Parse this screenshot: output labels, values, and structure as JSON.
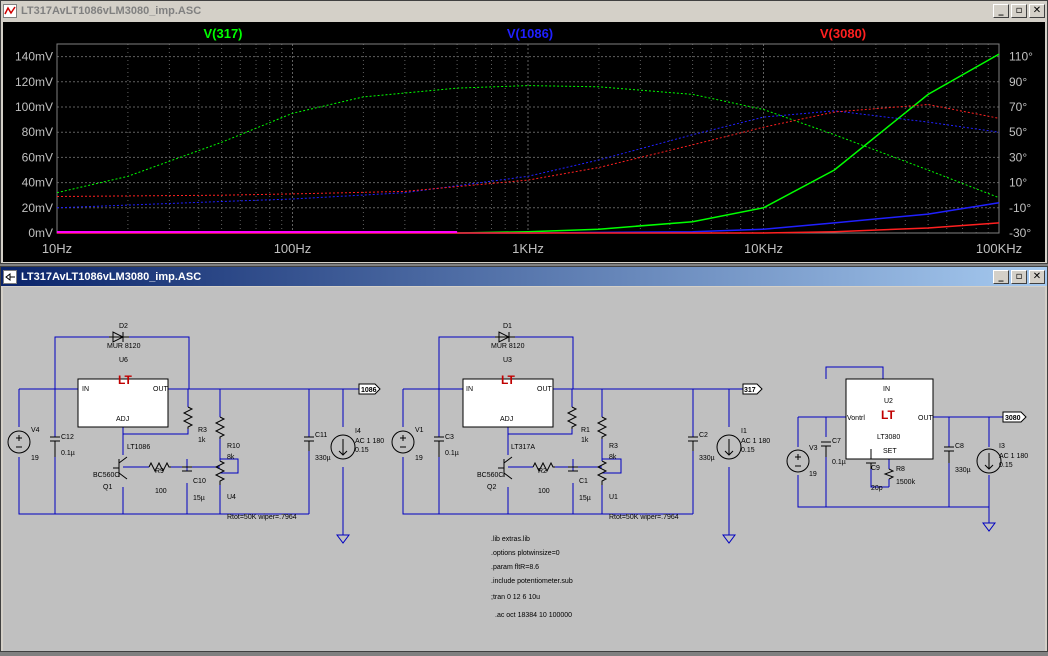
{
  "plot_window": {
    "title": "LT317AvLT1086vLM3080_imp.ASC",
    "buttons": {
      "minimize": "_",
      "restore": "▫",
      "close": "✕"
    }
  },
  "schematic_window": {
    "title": "LT317AvLT1086vLM3080_imp.ASC",
    "buttons": {
      "minimize": "_",
      "restore": "▫",
      "close": "✕"
    }
  },
  "colors": {
    "green": "#00ff00",
    "blue": "#2020ff",
    "red": "#ff2020",
    "wire": "#0000c0",
    "component": "#000000",
    "grid": "#606060"
  },
  "chart_data": {
    "type": "line",
    "xscale": "log",
    "xlim": [
      10,
      100000
    ],
    "x_ticks": [
      "10Hz",
      "100Hz",
      "1KHz",
      "10KHz",
      "100KHz"
    ],
    "ylim_left": [
      0,
      150
    ],
    "y_ticks_left": [
      "0mV",
      "20mV",
      "40mV",
      "60mV",
      "80mV",
      "100mV",
      "120mV",
      "140mV"
    ],
    "ylim_right": [
      -30,
      120
    ],
    "y_ticks_right": [
      "-30°",
      "-10°",
      "10°",
      "30°",
      "50°",
      "70°",
      "90°",
      "110°"
    ],
    "legend": [
      "V(317)",
      "V(1086)",
      "V(3080)"
    ],
    "series": [
      {
        "name": "V(317)",
        "color": "#00ff00",
        "magnitude": [
          [
            10,
            32
          ],
          [
            20,
            45
          ],
          [
            50,
            72
          ],
          [
            100,
            95
          ],
          [
            200,
            108
          ],
          [
            500,
            115
          ],
          [
            1000,
            117
          ],
          [
            2000,
            116
          ],
          [
            5000,
            110
          ],
          [
            10000,
            98
          ],
          [
            20000,
            78
          ],
          [
            50000,
            50
          ],
          [
            100000,
            28
          ]
        ],
        "phase": [
          [
            500,
            -30
          ],
          [
            1000,
            -29
          ],
          [
            2000,
            -27
          ],
          [
            5000,
            -21
          ],
          [
            10000,
            -10
          ],
          [
            20000,
            20
          ],
          [
            50000,
            80
          ],
          [
            100000,
            112
          ]
        ]
      },
      {
        "name": "V(1086)",
        "color": "#2020ff",
        "magnitude": [
          [
            10,
            20
          ],
          [
            50,
            25
          ],
          [
            100,
            27
          ],
          [
            300,
            32
          ],
          [
            1000,
            45
          ],
          [
            2000,
            58
          ],
          [
            5000,
            78
          ],
          [
            10000,
            92
          ],
          [
            20000,
            97
          ],
          [
            50000,
            88
          ],
          [
            100000,
            80
          ]
        ],
        "phase": [
          [
            10,
            -30
          ],
          [
            1000,
            -30
          ],
          [
            5000,
            -29
          ],
          [
            10000,
            -27
          ],
          [
            20000,
            -22
          ],
          [
            50000,
            -15
          ],
          [
            100000,
            -6
          ]
        ]
      },
      {
        "name": "V(3080)",
        "color": "#ff2020",
        "magnitude": [
          [
            10,
            29
          ],
          [
            50,
            30
          ],
          [
            100,
            31
          ],
          [
            300,
            33
          ],
          [
            1000,
            42
          ],
          [
            2000,
            52
          ],
          [
            5000,
            70
          ],
          [
            10000,
            84
          ],
          [
            20000,
            96
          ],
          [
            50000,
            102
          ],
          [
            100000,
            91
          ]
        ],
        "phase": [
          [
            10,
            -30
          ],
          [
            5000,
            -30
          ],
          [
            10000,
            -30
          ],
          [
            20000,
            -29
          ],
          [
            50000,
            -26
          ],
          [
            100000,
            -22
          ]
        ]
      }
    ]
  },
  "schematic": {
    "circuit1": {
      "D2": "D2",
      "D2_model": "MUR 8120",
      "U6": "U6",
      "U6_in": "IN",
      "U6_out": "OUT",
      "U6_adj": "ADJ",
      "U6_part": "LT1086",
      "V4": "V4",
      "V4_val": "19",
      "C12": "C12",
      "C12_val": "0.1µ",
      "Q1_model": "BC560C",
      "Q1": "Q1",
      "R9": "R9",
      "R9_val": "100",
      "R3": "R3",
      "R3_val": "1k",
      "R10": "R10",
      "R10_val": "8k",
      "C10": "C10",
      "C10_val": "15µ",
      "U4": "U4",
      "U4_val": "Rtot=50K wiper=.7964",
      "C11": "C11",
      "C11_val": "330µ",
      "I4": "I4",
      "I4_val1": "AC 1 180",
      "I4_val2": "0.15",
      "net": "1086"
    },
    "circuit2": {
      "D1": "D1",
      "D1_model": "MUR 8120",
      "U3": "U3",
      "U3_in": "IN",
      "U3_out": "OUT",
      "U3_adj": "ADJ",
      "U3_part": "LT317A",
      "V1": "V1",
      "V1_val": "19",
      "C3": "C3",
      "C3_val": "0.1µ",
      "Q2_model": "BC560C",
      "Q2": "Q2",
      "R2": "R2",
      "R2_val": "100",
      "R1": "R1",
      "R1_val": "1k",
      "R3": "R3",
      "R3_val": "8k",
      "C1": "C1",
      "C1_val": "15µ",
      "U1": "U1",
      "U1_val": "Rtot=50K wiper=.7964",
      "C2": "C2",
      "C2_val": "330µ",
      "I1": "I1",
      "I1_val1": "AC 1 180",
      "I1_val2": "0.15",
      "net": "317"
    },
    "circuit3": {
      "U2": "U2",
      "U2_in": "IN",
      "U2_vcontrol": "Vontrl",
      "U2_out": "OUT",
      "U2_part": "LT3080",
      "U2_set": "SET",
      "V3": "V3",
      "V3_val": "19",
      "C7": "C7",
      "C7_val": "0.1µ",
      "C9": "C9",
      "C9_val": "20p",
      "R8": "R8",
      "R8_val": "1500k",
      "C8": "C8",
      "C8_val": "330µ",
      "I3": "I3",
      "I3_val1": "AC 1 180",
      "I3_val2": "0.15",
      "net": "3080"
    },
    "directives": [
      ".lib extras.lib",
      ".options plotwinsize=0",
      ".param fltR=8.6",
      ".include potentiometer.sub",
      ";tran 0 12 6 10u",
      ".ac oct 18384 10 100000"
    ]
  }
}
